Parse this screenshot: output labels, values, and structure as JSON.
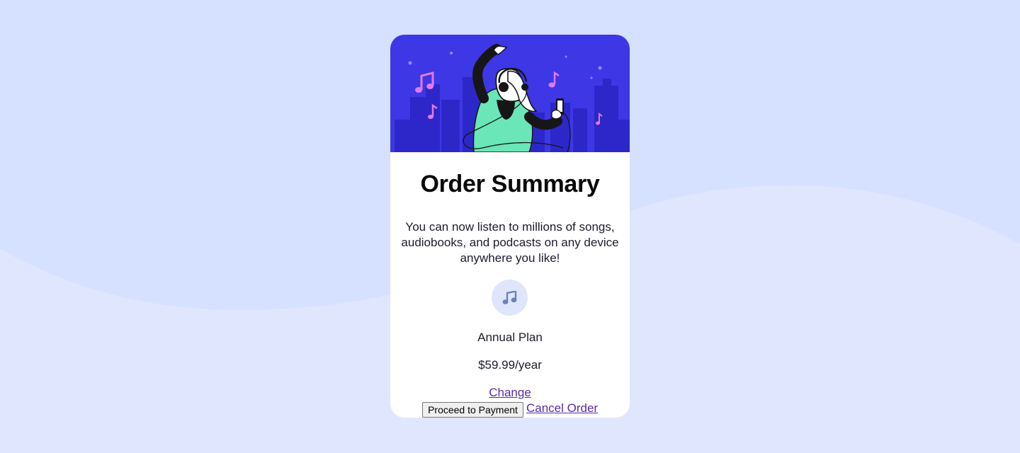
{
  "colors": {
    "page_background": "#e0e6fe",
    "wave": "#d6e1ff",
    "hero_background": "#3d37e6",
    "accent_link": "#5a2aa6",
    "icon_circle": "#dfe6fb"
  },
  "card": {
    "hero_icon": "dancing-person-with-headphones-illustration",
    "title": "Order Summary",
    "description": "You can now listen to millions of songs, audiobooks, and podcasts on any device anywhere you like!",
    "plan": {
      "icon": "music-note-icon",
      "name": "Annual Plan",
      "price": "$59.99/year",
      "change_label": "Change"
    },
    "proceed_label": "Proceed to Payment",
    "cancel_label": "Cancel Order"
  }
}
